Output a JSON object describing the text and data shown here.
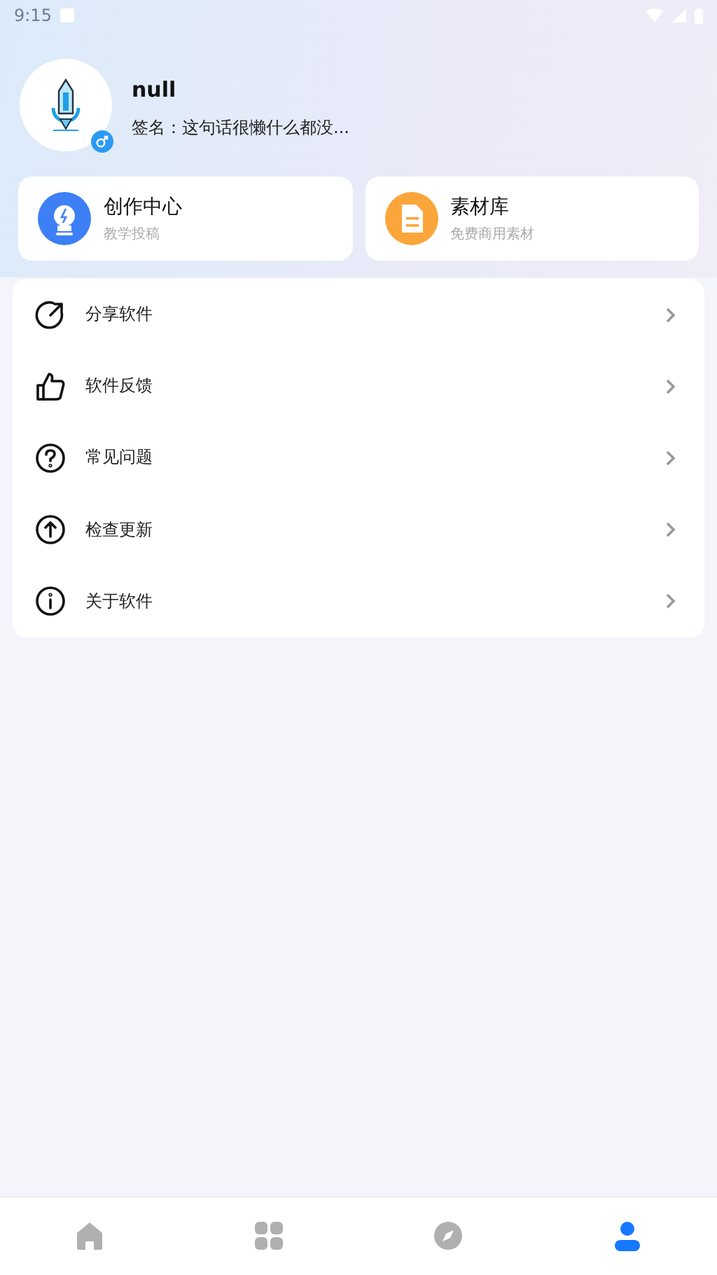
{
  "status_bar": {
    "time": "9:15"
  },
  "profile": {
    "name": "null",
    "signature": "签名：这句话很懒什么都没..."
  },
  "feature_cards": [
    {
      "kind": "bulb",
      "title": "创作中心",
      "subtitle": "教学投稿",
      "color": "#3d7ff5"
    },
    {
      "kind": "document",
      "title": "素材库",
      "subtitle": "免费商用素材",
      "color": "#fba63a"
    }
  ],
  "menu": [
    {
      "kind": "share",
      "label": "分享软件"
    },
    {
      "kind": "like",
      "label": "软件反馈"
    },
    {
      "kind": "question",
      "label": "常见问题"
    },
    {
      "kind": "update",
      "label": "检查更新"
    },
    {
      "kind": "info",
      "label": "关于软件"
    }
  ],
  "tab_bar": [
    {
      "kind": "home",
      "selected": false
    },
    {
      "kind": "apps",
      "selected": false
    },
    {
      "kind": "discover",
      "selected": false
    },
    {
      "kind": "profile",
      "selected": true
    }
  ]
}
